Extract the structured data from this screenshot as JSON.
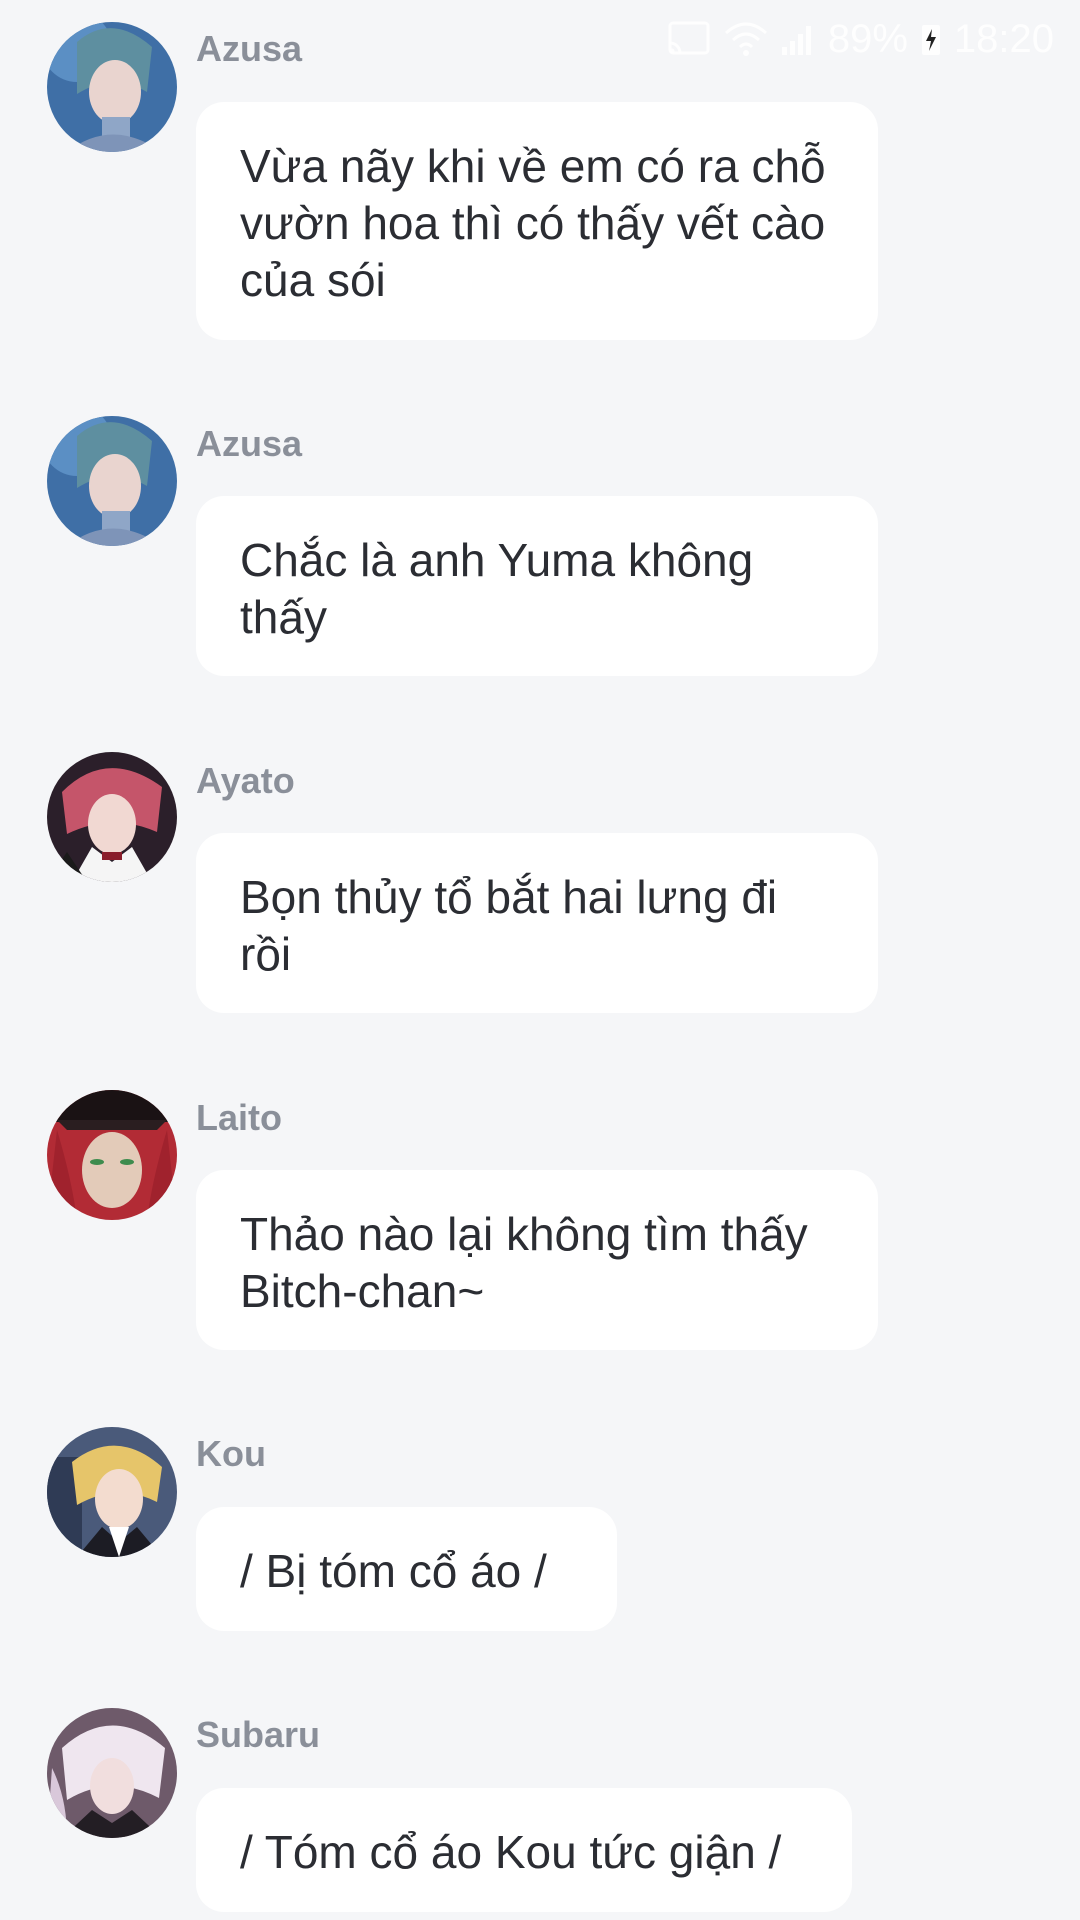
{
  "status_bar": {
    "battery": "89%",
    "time": "18:20",
    "icons": [
      "cast-icon",
      "wifi-icon",
      "signal-icon",
      "battery-charging-icon"
    ]
  },
  "messages": [
    {
      "sender": "Azusa",
      "avatar": "azusa-avatar",
      "text": "Vừa nãy khi về em có ra chỗ vườn hoa thì có thấy vết cào của sói"
    },
    {
      "sender": "Azusa",
      "avatar": "azusa-avatar",
      "text": "Chắc là anh Yuma không thấy"
    },
    {
      "sender": "Ayato",
      "avatar": "ayato-avatar",
      "text": "Bọn thủy tổ bắt hai lưng đi rồi"
    },
    {
      "sender": "Laito",
      "avatar": "laito-avatar",
      "text": "Thảo nào lại không tìm thấy Bitch-chan~"
    },
    {
      "sender": "Kou",
      "avatar": "kou-avatar",
      "text": "/ Bị tóm cổ áo /"
    },
    {
      "sender": "Subaru",
      "avatar": "subaru-avatar",
      "text": "/ Tóm cổ áo Kou tức giận /"
    }
  ],
  "colors": {
    "background": "#f5f6f8",
    "bubble": "#ffffff",
    "sender_text": "#8a8f99",
    "message_text": "#2b2d33"
  }
}
